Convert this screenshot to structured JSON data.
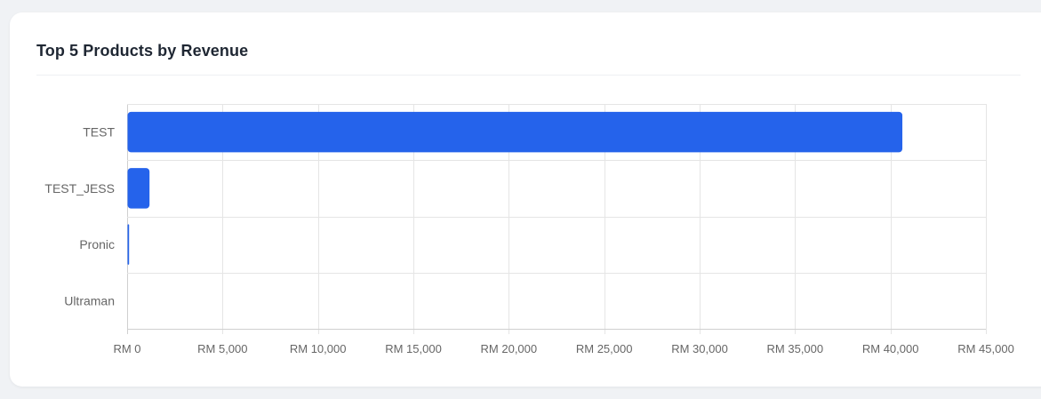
{
  "card": {
    "title": "Top 5 Products by Revenue"
  },
  "colors": {
    "bar": "#2563eb",
    "grid": "#e5e5e5",
    "axis": "#d0d0d0",
    "tick_text": "#666666"
  },
  "chart_data": {
    "type": "bar",
    "orientation": "horizontal",
    "title": "Top 5 Products by Revenue",
    "categories": [
      "TEST",
      "TEST_JESS",
      "Pronic",
      "Ultraman"
    ],
    "values": [
      40600,
      1150,
      80,
      0
    ],
    "xlim": [
      0,
      45000
    ],
    "x_ticks": [
      0,
      5000,
      10000,
      15000,
      20000,
      25000,
      30000,
      35000,
      40000,
      45000
    ],
    "x_tick_labels": [
      "RM 0",
      "RM 5,000",
      "RM 10,000",
      "RM 15,000",
      "RM 20,000",
      "RM 25,000",
      "RM 30,000",
      "RM 35,000",
      "RM 40,000",
      "RM 45,000"
    ],
    "grid": true,
    "legend": "none",
    "xlabel": "",
    "ylabel": ""
  }
}
